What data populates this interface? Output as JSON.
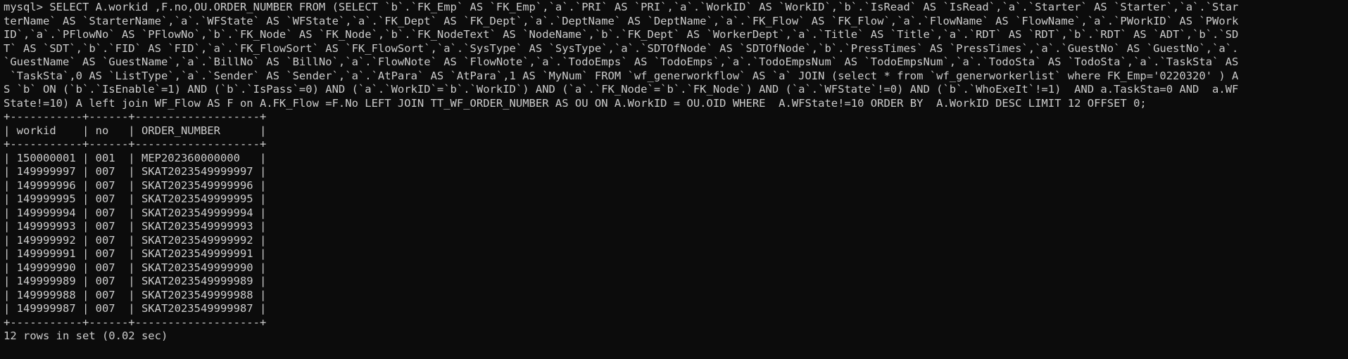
{
  "terminal": {
    "query_lines": [
      "mysql> SELECT A.workid ,F.no,OU.ORDER_NUMBER FROM (SELECT `b`.`FK_Emp` AS `FK_Emp`,`a`.`PRI` AS `PRI`,`a`.`WorkID` AS `WorkID`,`b`.`IsRead` AS `IsRead`,`a`.`Starter` AS `Starter`,`a`.`Star",
      "terName` AS `StarterName`,`a`.`WFState` AS `WFState`,`a`.`FK_Dept` AS `FK_Dept`,`a`.`DeptName` AS `DeptName`,`a`.`FK_Flow` AS `FK_Flow`,`a`.`FlowName` AS `FlowName`,`a`.`PWorkID` AS `PWork",
      "ID`,`a`.`PFlowNo` AS `PFlowNo`,`b`.`FK_Node` AS `FK_Node`,`b`.`FK_NodeText` AS `NodeName`,`b`.`FK_Dept` AS `WorkerDept`,`a`.`Title` AS `Title`,`a`.`RDT` AS `RDT`,`b`.`RDT` AS `ADT`,`b`.`SD",
      "T` AS `SDT`,`b`.`FID` AS `FID`,`a`.`FK_FlowSort` AS `FK_FlowSort`,`a`.`SysType` AS `SysType`,`a`.`SDTOfNode` AS `SDTOfNode`,`b`.`PressTimes` AS `PressTimes`,`a`.`GuestNo` AS `GuestNo`,`a`.",
      "`GuestName` AS `GuestName`,`a`.`BillNo` AS `BillNo`,`a`.`FlowNote` AS `FlowNote`,`a`.`TodoEmps` AS `TodoEmps`,`a`.`TodoEmpsNum` AS `TodoEmpsNum`,`a`.`TodoSta` AS `TodoSta`,`a`.`TaskSta` AS",
      " `TaskSta`,0 AS `ListType`,`a`.`Sender` AS `Sender`,`a`.`AtPara` AS `AtPara`,1 AS `MyNum` FROM `wf_generworkflow` AS `a` JOIN (select * from `wf_generworkerlist` where FK_Emp='0220320' ) A",
      "S `b` ON (`b`.`IsEnable`=1) AND (`b`.`IsPass`=0) AND (`a`.`WorkID`=`b`.`WorkID`) AND (`a`.`FK_Node`=`b`.`FK_Node`) AND (`a`.`WFState`!=0) AND (`b`.`WhoExeIt`!=1)  AND a.TaskSta=0 AND  a.WF",
      "State!=10) A left join WF_Flow AS F on A.FK_Flow =F.No LEFT JOIN TT_WF_ORDER_NUMBER AS OU ON A.WorkID = OU.OID WHERE  A.WFState!=10 ORDER BY  A.WorkID DESC LIMIT 12 OFFSET 0;"
    ],
    "result": {
      "border": "+-----------+------+-------------------+",
      "header": "| workid    | no   | ORDER_NUMBER      |",
      "rows": [
        "| 150000001 | 001  | MEP202360000000   |",
        "| 149999997 | 007  | SKAT2023549999997 |",
        "| 149999996 | 007  | SKAT2023549999996 |",
        "| 149999995 | 007  | SKAT2023549999995 |",
        "| 149999994 | 007  | SKAT2023549999994 |",
        "| 149999993 | 007  | SKAT2023549999993 |",
        "| 149999992 | 007  | SKAT2023549999992 |",
        "| 149999991 | 007  | SKAT2023549999991 |",
        "| 149999990 | 007  | SKAT2023549999990 |",
        "| 149999989 | 007  | SKAT2023549999989 |",
        "| 149999988 | 007  | SKAT2023549999988 |",
        "| 149999987 | 007  | SKAT2023549999987 |"
      ],
      "summary": "12 rows in set (0.02 sec)"
    },
    "colors": {
      "background": "#0c0c0c",
      "foreground": "#cccccc"
    }
  }
}
